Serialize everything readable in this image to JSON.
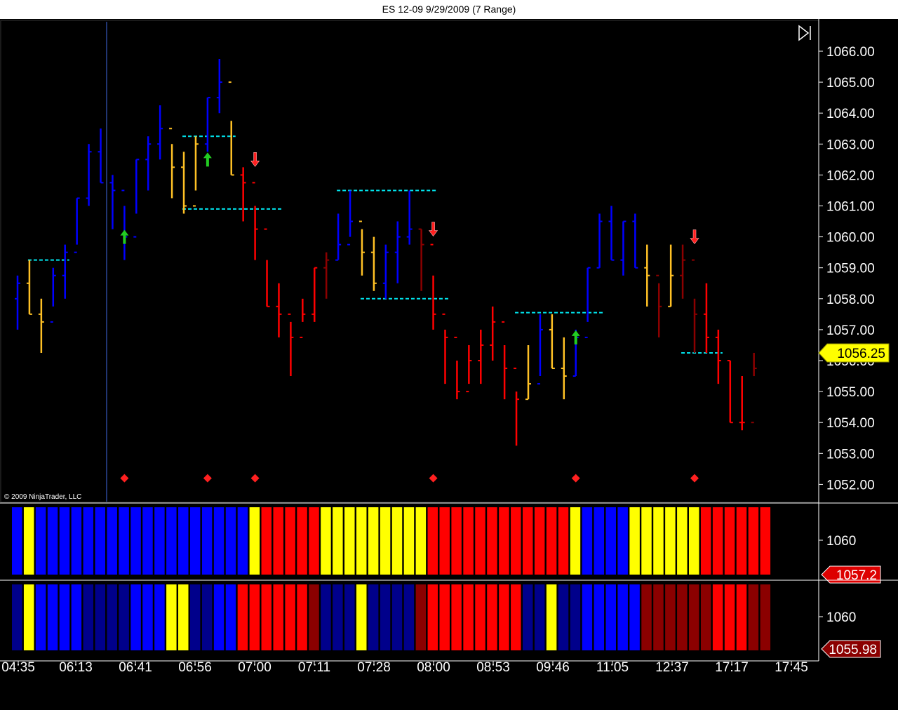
{
  "window": {
    "title": "ES 12-09  9/29/2009 (7 Range)"
  },
  "copyright": "© 2009 NinjaTrader, LLC",
  "colors": {
    "background": "#000000",
    "up": "#0000ff",
    "up_dark": "#00008b",
    "neutral": "#ffc125",
    "down": "#ff0000",
    "down_dark": "#8b0000",
    "yellow": "#ffff00",
    "level_line": "#00e5ee",
    "divider": "#ffffff"
  },
  "chart_data": [
    {
      "type": "bar",
      "subtype": "ohlc-range-bars",
      "title": "ES 12-09  9/29/2009 (7 Range)",
      "ylim": [
        1051.6,
        1067.2
      ],
      "y_ticks": [
        "1066.00",
        "1065.00",
        "1064.00",
        "1063.00",
        "1062.00",
        "1061.00",
        "1060.00",
        "1059.00",
        "1058.00",
        "1057.00",
        "1056.00",
        "1055.00",
        "1054.00",
        "1053.00",
        "1052.00"
      ],
      "last_price_label": "1056.25",
      "x_tick_labels": [
        "04:35",
        "06:13",
        "06:41",
        "06:56",
        "07:00",
        "07:11",
        "07:28",
        "08:00",
        "08:53",
        "09:46",
        "11:05",
        "12:37",
        "17:17",
        "17:45"
      ],
      "bars": [
        {
          "o": 1058.0,
          "h": 1058.75,
          "l": 1057.0,
          "c": 1058.5,
          "color": "up"
        },
        {
          "o": 1058.5,
          "h": 1059.25,
          "l": 1057.5,
          "c": 1057.5,
          "color": "neutral"
        },
        {
          "o": 1057.5,
          "h": 1058.0,
          "l": 1056.25,
          "c": 1057.25,
          "color": "neutral"
        },
        {
          "o": 1057.25,
          "h": 1059.0,
          "l": 1057.75,
          "c": 1058.75,
          "color": "up"
        },
        {
          "o": 1058.75,
          "h": 1059.75,
          "l": 1058.0,
          "c": 1059.5,
          "color": "up"
        },
        {
          "o": 1059.5,
          "h": 1061.25,
          "l": 1059.75,
          "c": 1061.25,
          "color": "up"
        },
        {
          "o": 1061.25,
          "h": 1063.0,
          "l": 1061.0,
          "c": 1062.75,
          "color": "up"
        },
        {
          "o": 1062.75,
          "h": 1063.5,
          "l": 1061.75,
          "c": 1061.75,
          "color": "up"
        },
        {
          "o": 1061.75,
          "h": 1062.0,
          "l": 1060.25,
          "c": 1061.5,
          "color": "up"
        },
        {
          "o": 1061.5,
          "h": 1061.0,
          "l": 1059.25,
          "c": 1060.0,
          "color": "up"
        },
        {
          "o": 1060.0,
          "h": 1062.5,
          "l": 1060.75,
          "c": 1062.5,
          "color": "up"
        },
        {
          "o": 1062.5,
          "h": 1063.25,
          "l": 1061.5,
          "c": 1063.0,
          "color": "up"
        },
        {
          "o": 1063.0,
          "h": 1064.25,
          "l": 1062.5,
          "c": 1063.5,
          "color": "up"
        },
        {
          "o": 1063.5,
          "h": 1063.0,
          "l": 1061.25,
          "c": 1062.25,
          "color": "neutral"
        },
        {
          "o": 1062.25,
          "h": 1062.75,
          "l": 1060.75,
          "c": 1061.0,
          "color": "neutral"
        },
        {
          "o": 1061.0,
          "h": 1063.25,
          "l": 1061.5,
          "c": 1063.0,
          "color": "neutral"
        },
        {
          "o": 1063.0,
          "h": 1064.5,
          "l": 1062.75,
          "c": 1064.5,
          "color": "up"
        },
        {
          "o": 1064.5,
          "h": 1065.75,
          "l": 1064.0,
          "c": 1065.0,
          "color": "up"
        },
        {
          "o": 1065.0,
          "h": 1063.75,
          "l": 1062.0,
          "c": 1062.0,
          "color": "neutral"
        },
        {
          "o": 1062.0,
          "h": 1062.25,
          "l": 1060.5,
          "c": 1061.75,
          "color": "down"
        },
        {
          "o": 1061.75,
          "h": 1061.0,
          "l": 1059.25,
          "c": 1060.25,
          "color": "down"
        },
        {
          "o": 1060.25,
          "h": 1059.25,
          "l": 1057.75,
          "c": 1057.75,
          "color": "down"
        },
        {
          "o": 1057.75,
          "h": 1058.5,
          "l": 1056.75,
          "c": 1057.5,
          "color": "down"
        },
        {
          "o": 1057.5,
          "h": 1057.25,
          "l": 1055.5,
          "c": 1056.75,
          "color": "down"
        },
        {
          "o": 1056.75,
          "h": 1058.0,
          "l": 1057.25,
          "c": 1057.5,
          "color": "down"
        },
        {
          "o": 1057.5,
          "h": 1059.0,
          "l": 1057.25,
          "c": 1059.0,
          "color": "down"
        },
        {
          "o": 1059.0,
          "h": 1059.5,
          "l": 1058.0,
          "c": 1059.25,
          "color": "down_dark"
        },
        {
          "o": 1059.25,
          "h": 1060.75,
          "l": 1059.25,
          "c": 1059.75,
          "color": "up"
        },
        {
          "o": 1059.75,
          "h": 1061.5,
          "l": 1060.0,
          "c": 1060.5,
          "color": "up"
        },
        {
          "o": 1060.5,
          "h": 1060.25,
          "l": 1058.75,
          "c": 1059.5,
          "color": "neutral"
        },
        {
          "o": 1059.5,
          "h": 1060.0,
          "l": 1058.25,
          "c": 1058.5,
          "color": "neutral"
        },
        {
          "o": 1058.5,
          "h": 1059.75,
          "l": 1058.0,
          "c": 1059.5,
          "color": "up"
        },
        {
          "o": 1059.5,
          "h": 1060.5,
          "l": 1058.5,
          "c": 1060.0,
          "color": "up"
        },
        {
          "o": 1060.0,
          "h": 1061.5,
          "l": 1059.75,
          "c": 1060.25,
          "color": "up"
        },
        {
          "o": 1060.25,
          "h": 1060.25,
          "l": 1058.25,
          "c": 1059.75,
          "color": "down_dark"
        },
        {
          "o": 1059.75,
          "h": 1058.75,
          "l": 1057.0,
          "c": 1057.5,
          "color": "down"
        },
        {
          "o": 1057.5,
          "h": 1057.0,
          "l": 1055.25,
          "c": 1056.75,
          "color": "down"
        },
        {
          "o": 1056.75,
          "h": 1056.0,
          "l": 1054.75,
          "c": 1055.0,
          "color": "down"
        },
        {
          "o": 1055.0,
          "h": 1056.5,
          "l": 1055.25,
          "c": 1056.0,
          "color": "down"
        },
        {
          "o": 1056.0,
          "h": 1057.0,
          "l": 1055.25,
          "c": 1056.5,
          "color": "down"
        },
        {
          "o": 1056.5,
          "h": 1057.75,
          "l": 1056.0,
          "c": 1057.25,
          "color": "down"
        },
        {
          "o": 1057.25,
          "h": 1056.5,
          "l": 1054.75,
          "c": 1055.75,
          "color": "down"
        },
        {
          "o": 1055.75,
          "h": 1055.0,
          "l": 1053.25,
          "c": 1054.75,
          "color": "down"
        },
        {
          "o": 1054.75,
          "h": 1056.5,
          "l": 1054.75,
          "c": 1055.25,
          "color": "neutral"
        },
        {
          "o": 1055.25,
          "h": 1057.5,
          "l": 1055.5,
          "c": 1057.0,
          "color": "up"
        },
        {
          "o": 1057.0,
          "h": 1057.5,
          "l": 1055.75,
          "c": 1055.75,
          "color": "neutral"
        },
        {
          "o": 1055.75,
          "h": 1056.75,
          "l": 1054.75,
          "c": 1055.5,
          "color": "neutral"
        },
        {
          "o": 1055.5,
          "h": 1057.0,
          "l": 1055.5,
          "c": 1056.75,
          "color": "up"
        },
        {
          "o": 1056.75,
          "h": 1059.0,
          "l": 1057.25,
          "c": 1059.0,
          "color": "up"
        },
        {
          "o": 1059.0,
          "h": 1060.75,
          "l": 1059.0,
          "c": 1060.5,
          "color": "up"
        },
        {
          "o": 1060.5,
          "h": 1061.0,
          "l": 1059.25,
          "c": 1059.25,
          "color": "up"
        },
        {
          "o": 1059.25,
          "h": 1060.5,
          "l": 1058.75,
          "c": 1060.5,
          "color": "up"
        },
        {
          "o": 1060.5,
          "h": 1060.75,
          "l": 1059.0,
          "c": 1059.0,
          "color": "up"
        },
        {
          "o": 1059.0,
          "h": 1059.75,
          "l": 1057.75,
          "c": 1058.75,
          "color": "neutral"
        },
        {
          "o": 1058.75,
          "h": 1058.5,
          "l": 1056.75,
          "c": 1057.75,
          "color": "down_dark"
        },
        {
          "o": 1057.75,
          "h": 1059.75,
          "l": 1057.75,
          "c": 1058.75,
          "color": "neutral"
        },
        {
          "o": 1058.75,
          "h": 1059.75,
          "l": 1058.0,
          "c": 1059.25,
          "color": "down_dark"
        },
        {
          "o": 1059.25,
          "h": 1058.0,
          "l": 1056.25,
          "c": 1057.5,
          "color": "down_dark"
        },
        {
          "o": 1057.5,
          "h": 1058.5,
          "l": 1056.25,
          "c": 1056.75,
          "color": "down"
        },
        {
          "o": 1056.75,
          "h": 1057.0,
          "l": 1055.25,
          "c": 1056.0,
          "color": "down"
        },
        {
          "o": 1056.0,
          "h": 1056.0,
          "l": 1054.0,
          "c": 1054.0,
          "color": "down"
        },
        {
          "o": 1054.0,
          "h": 1055.5,
          "l": 1053.75,
          "c": 1054.0,
          "color": "down"
        },
        {
          "o": 1054.0,
          "h": 1056.25,
          "l": 1055.5,
          "c": 1055.75,
          "color": "down_dark"
        }
      ],
      "buy_arrows": [
        {
          "bar": 9,
          "price": 1060.0
        },
        {
          "bar": 16,
          "price": 1062.5
        },
        {
          "bar": 47,
          "price": 1056.75
        }
      ],
      "sell_arrows": [
        {
          "bar": 20,
          "price": 1062.5
        },
        {
          "bar": 35,
          "price": 1060.25
        },
        {
          "bar": 57,
          "price": 1060.0
        }
      ],
      "signal_diamonds": [
        {
          "bar": 9,
          "price": 1052.2
        },
        {
          "bar": 16,
          "price": 1052.2
        },
        {
          "bar": 20,
          "price": 1052.2
        },
        {
          "bar": 35,
          "price": 1052.2
        },
        {
          "bar": 47,
          "price": 1052.2
        },
        {
          "bar": 57,
          "price": 1052.2
        }
      ],
      "support_resistance": [
        {
          "from_bar": 1,
          "to_bar": 4,
          "price": 1059.25
        },
        {
          "from_bar": 14,
          "to_bar": 18,
          "price": 1063.25
        },
        {
          "from_bar": 14,
          "to_bar": 22,
          "price": 1060.9
        },
        {
          "from_bar": 27,
          "to_bar": 35,
          "price": 1061.5
        },
        {
          "from_bar": 29,
          "to_bar": 36,
          "price": 1058.0
        },
        {
          "from_bar": 42,
          "to_bar": 49,
          "price": 1057.55
        },
        {
          "from_bar": 56,
          "to_bar": 59,
          "price": 1056.25
        }
      ],
      "session_break_bar": 7.5
    },
    {
      "type": "bar",
      "subtype": "colored-histogram",
      "y_tick": "1060",
      "value_label": "1057.2",
      "colors": [
        "up",
        "yellow",
        "up",
        "up",
        "up",
        "up",
        "up",
        "up",
        "up",
        "up",
        "up",
        "up",
        "up",
        "up",
        "up",
        "up",
        "up",
        "up",
        "up",
        "up",
        "yellow",
        "down",
        "down",
        "down",
        "down",
        "down",
        "yellow",
        "yellow",
        "yellow",
        "yellow",
        "yellow",
        "yellow",
        "yellow",
        "yellow",
        "yellow",
        "down",
        "down",
        "down",
        "down",
        "down",
        "down",
        "down",
        "down",
        "down",
        "down",
        "down",
        "down",
        "yellow",
        "up",
        "up",
        "up",
        "up",
        "yellow",
        "yellow",
        "yellow",
        "yellow",
        "yellow",
        "yellow",
        "down",
        "down",
        "down",
        "down",
        "down",
        "down"
      ]
    },
    {
      "type": "bar",
      "subtype": "colored-histogram",
      "y_tick": "1060",
      "value_label": "1055.98",
      "colors": [
        "up_dark",
        "yellow",
        "up",
        "up",
        "up",
        "up",
        "up_dark",
        "up_dark",
        "up_dark",
        "up_dark",
        "up",
        "up",
        "up",
        "yellow",
        "yellow",
        "up_dark",
        "up_dark",
        "up",
        "up",
        "down",
        "down",
        "down",
        "down",
        "down",
        "down",
        "down_dark",
        "up_dark",
        "up_dark",
        "up_dark",
        "yellow",
        "up_dark",
        "up_dark",
        "up_dark",
        "up_dark",
        "down_dark",
        "down",
        "down",
        "down",
        "down",
        "down",
        "down",
        "down",
        "down",
        "up_dark",
        "up_dark",
        "yellow",
        "up_dark",
        "up_dark",
        "up",
        "up",
        "up",
        "up",
        "up",
        "down_dark",
        "down_dark",
        "down_dark",
        "down_dark",
        "down_dark",
        "down_dark",
        "down",
        "down",
        "down",
        "down_dark",
        "down_dark"
      ]
    }
  ]
}
